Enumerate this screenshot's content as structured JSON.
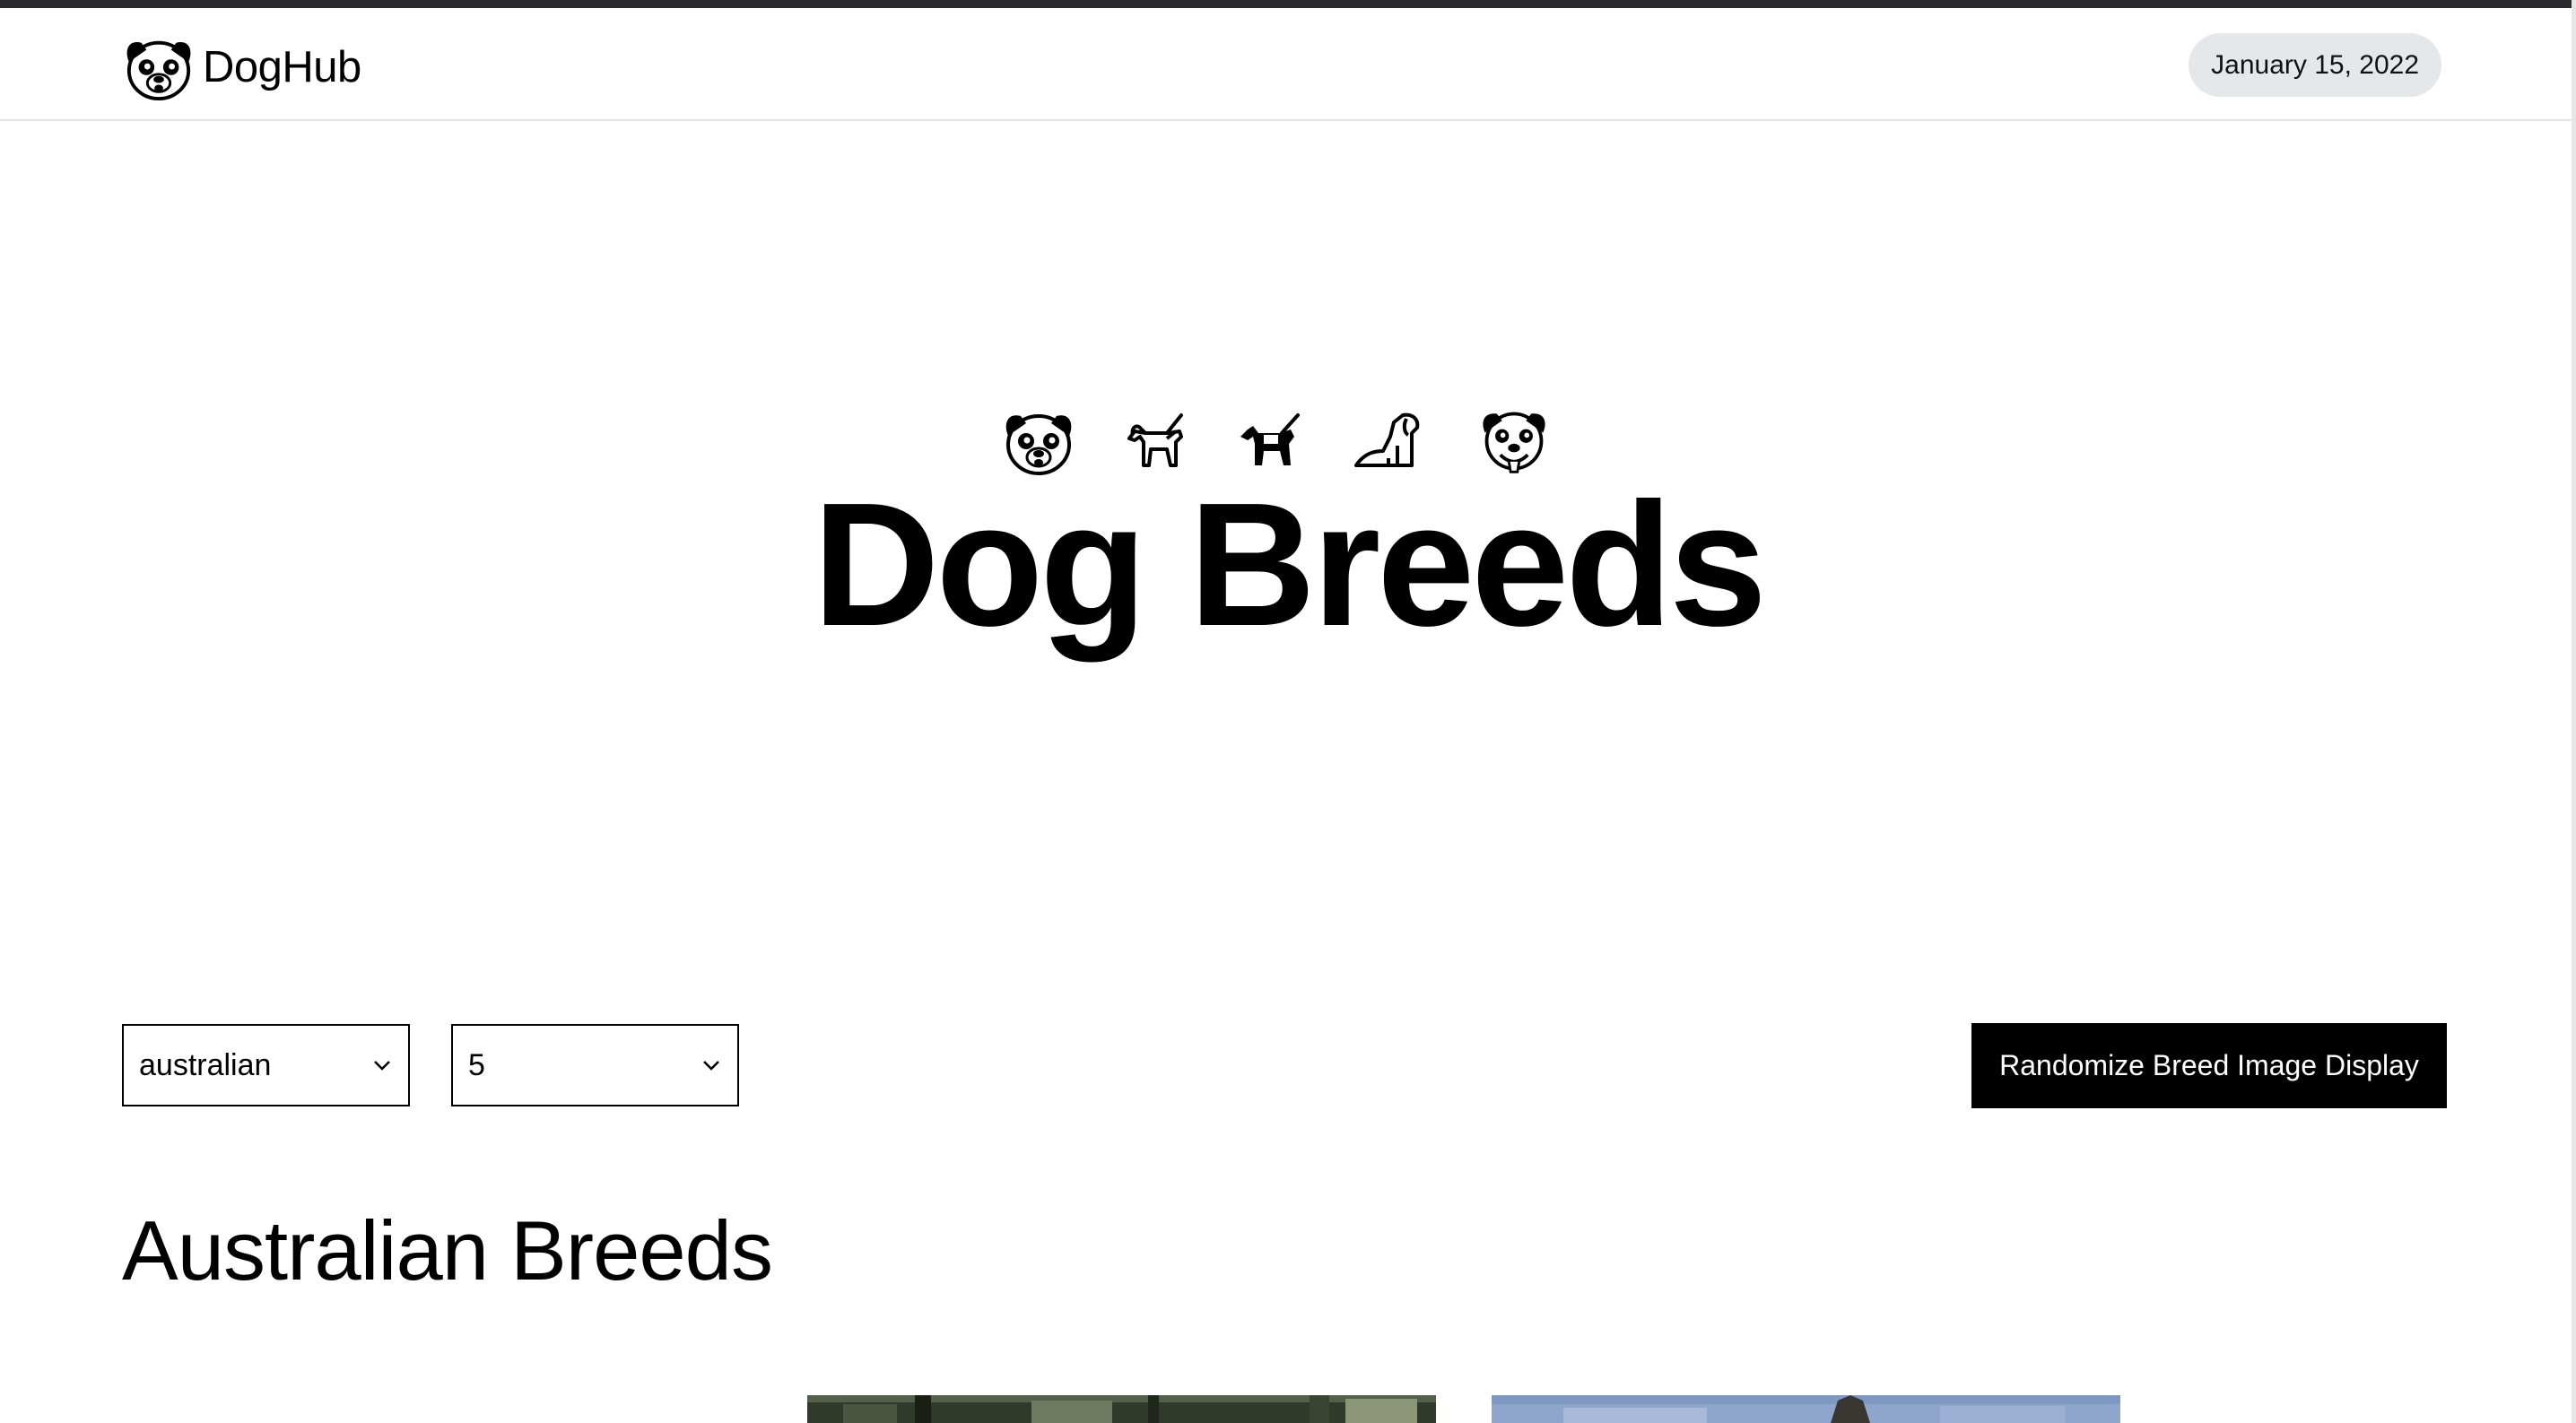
{
  "app": {
    "brand_name": "DogHub",
    "date": "January 15, 2022"
  },
  "hero": {
    "title": "Dog Breeds",
    "icons": [
      "pug-face-icon",
      "guide-dog-icon",
      "service-dog-icon",
      "sitting-dog-icon",
      "pug-smile-icon"
    ]
  },
  "controls": {
    "breed_select": {
      "value": "australian"
    },
    "count_select": {
      "value": "5"
    },
    "randomize_label": "Randomize Breed Image Display"
  },
  "section": {
    "title": "Australian Breeds"
  },
  "colors": {
    "accent": "#000000",
    "pill_bg": "#e5e7eb",
    "top_bar": "#2b2b2d"
  }
}
